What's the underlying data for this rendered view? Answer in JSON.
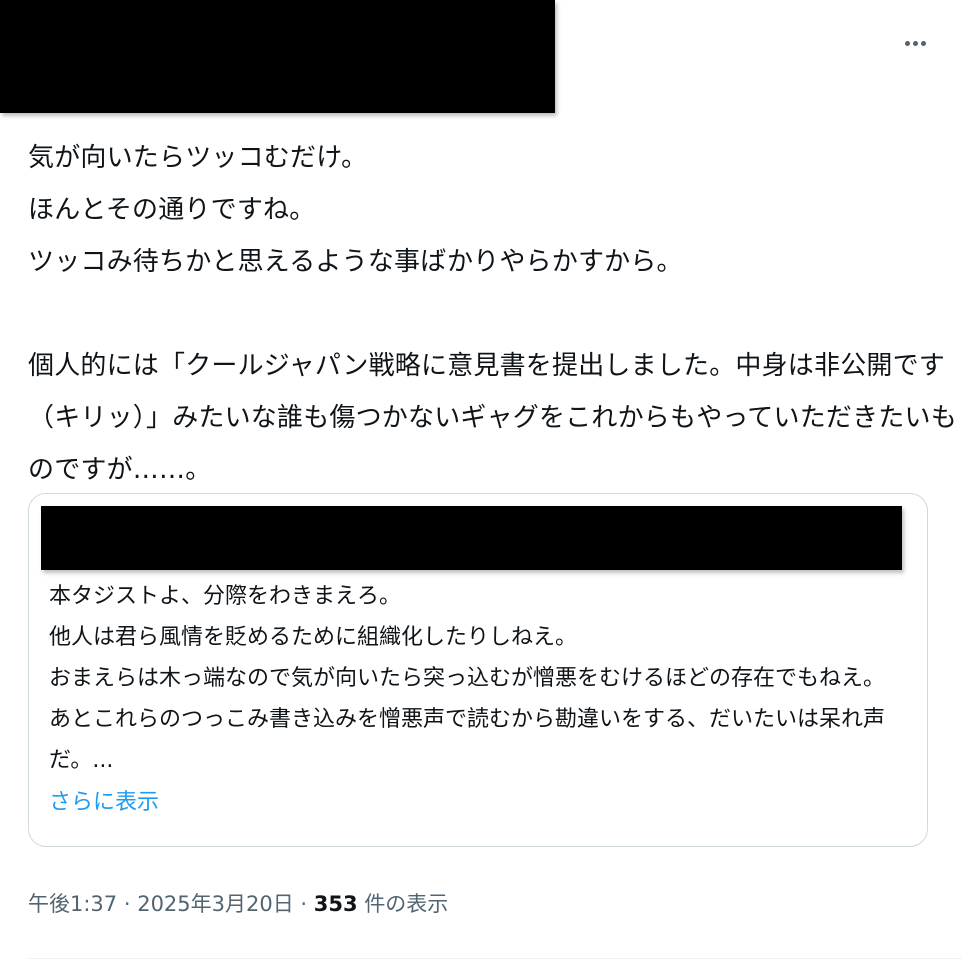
{
  "tweet": {
    "lines": [
      "気が向いたらツッコむだけ。",
      "ほんとその通りですね。",
      "ツッコみ待ちかと思えるような事ばかりやらかすから。",
      "",
      "個人的には「クールジャパン戦略に意見書を提出しました。中身は非公開です",
      "（キリッ）」みたいな誰も傷つかないギャグをこれからもやっていただきたいも",
      "のですが……。"
    ]
  },
  "quote": {
    "lines": [
      "本タジストよ、分際をわきまえろ。",
      "他人は君ら風情を貶めるために組織化したりしねえ。",
      "おまえらは木っ端なので気が向いたら突っ込むが憎悪をむけるほどの存在でもねえ。",
      "あとこれらのつっこみ書き込みを憎悪声で読むから勘違いをする、だいたいは呆れ声",
      "だ。..."
    ],
    "show_more_label": "さらに表示"
  },
  "meta": {
    "time": "午後1:37",
    "separator": " · ",
    "date": "2025年3月20日",
    "views_count": "353",
    "views_label": " 件の表示"
  },
  "colors": {
    "text": "#0f1419",
    "secondary": "#536471",
    "link": "#1d9bf0",
    "border": "#cfd9de"
  },
  "icons": {
    "more": "more-horizontal-icon"
  }
}
